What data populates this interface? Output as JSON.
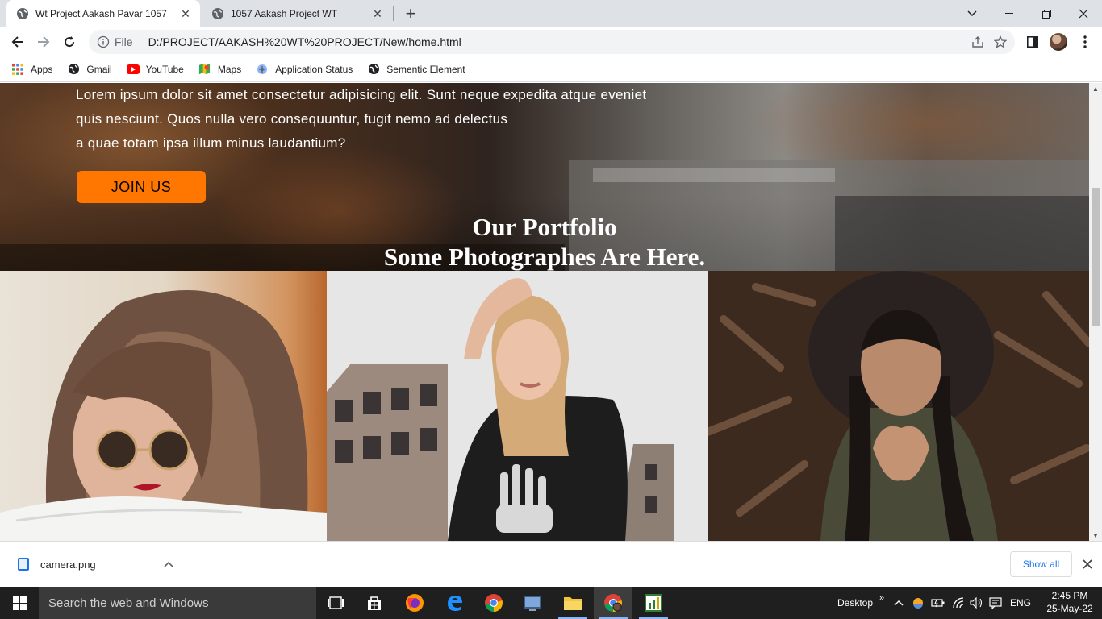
{
  "tabs": [
    {
      "title": "Wt Project Aakash Pavar 1057",
      "active": true
    },
    {
      "title": "1057 Aakash Project WT",
      "active": false
    }
  ],
  "omnibox": {
    "scheme": "File",
    "url": "D:/PROJECT/AAKASH%20WT%20PROJECT/New/home.html"
  },
  "bookmarks": [
    {
      "label": "Apps",
      "icon": "apps-grid-icon"
    },
    {
      "label": "Gmail",
      "icon": "globe-icon"
    },
    {
      "label": "YouTube",
      "icon": "youtube-icon"
    },
    {
      "label": "Maps",
      "icon": "maps-icon"
    },
    {
      "label": "Application Status",
      "icon": "application-status-icon"
    },
    {
      "label": "Sementic Element",
      "icon": "globe-icon"
    }
  ],
  "page": {
    "hero_lines": [
      "Lorem ipsum dolor sit amet consectetur adipisicing elit. Sunt neque expedita atque eveniet",
      "quis nesciunt. Quos nulla vero consequuntur, fugit nemo ad delectus",
      "a quae totam ipsa illum minus laudantium?"
    ],
    "join_label": "JOIN US",
    "portfolio_title": "Our Portfolio",
    "portfolio_subtitle": "Some Photographes Are Here."
  },
  "download": {
    "filename": "camera.png",
    "show_all": "Show all"
  },
  "taskbar": {
    "search_placeholder": "Search the web and Windows",
    "desktop_label": "Desktop",
    "language": "ENG",
    "time": "2:45 PM",
    "date": "25-May-22"
  },
  "colors": {
    "accent": "#ff7700",
    "link": "#1a73e8",
    "taskbar": "#1f1f1f"
  }
}
